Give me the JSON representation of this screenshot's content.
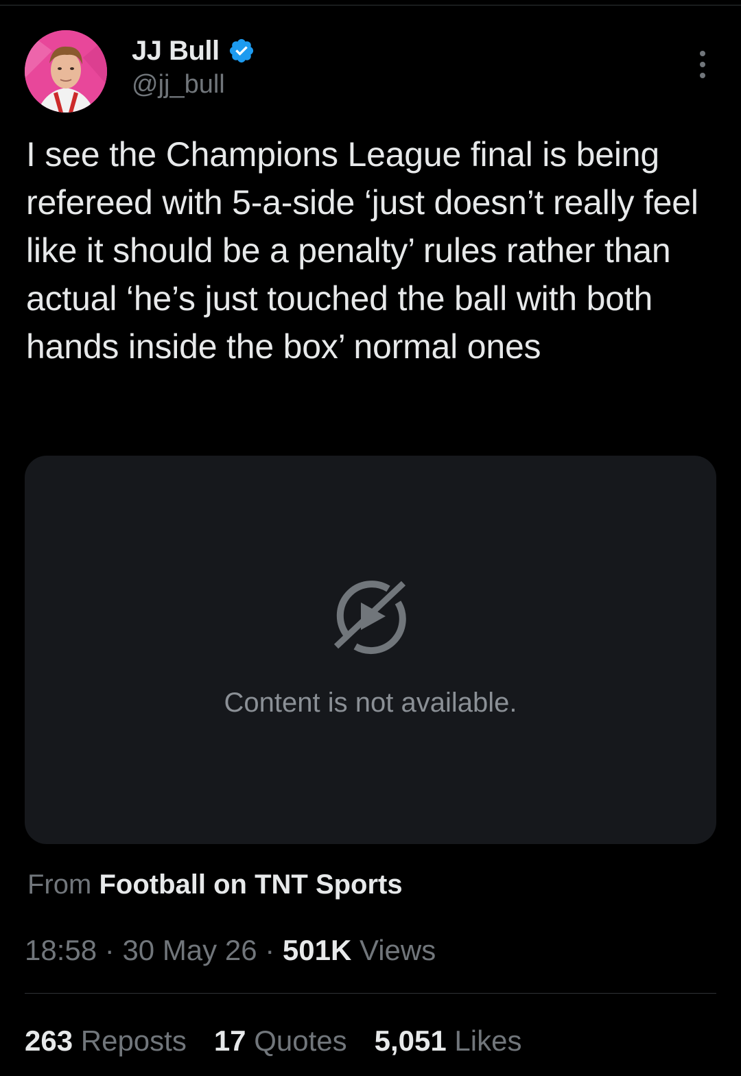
{
  "author": {
    "display_name": "JJ Bull",
    "handle": "@jj_bull",
    "verified_icon": "verified-badge-icon",
    "accent_color": "#1d9bf0"
  },
  "tweet": {
    "text": "I see the Champions League final is being refereed with 5-a-side ‘just doesn’t really feel like it should be a penalty’ rules rather than actual ‘he’s just touched the ball with both hands inside the box’ normal ones"
  },
  "media": {
    "icon": "video-unavailable-icon",
    "message": "Content is not available."
  },
  "source": {
    "prefix": "From",
    "name": "Football on TNT Sports"
  },
  "meta": {
    "time": "18:58",
    "separator": " · ",
    "date": "30 May 26",
    "views_count": "501K",
    "views_label": "Views"
  },
  "stats": {
    "reposts_count": "263",
    "reposts_label": "Reposts",
    "quotes_count": "17",
    "quotes_label": "Quotes",
    "likes_count": "5,051",
    "likes_label": "Likes"
  }
}
